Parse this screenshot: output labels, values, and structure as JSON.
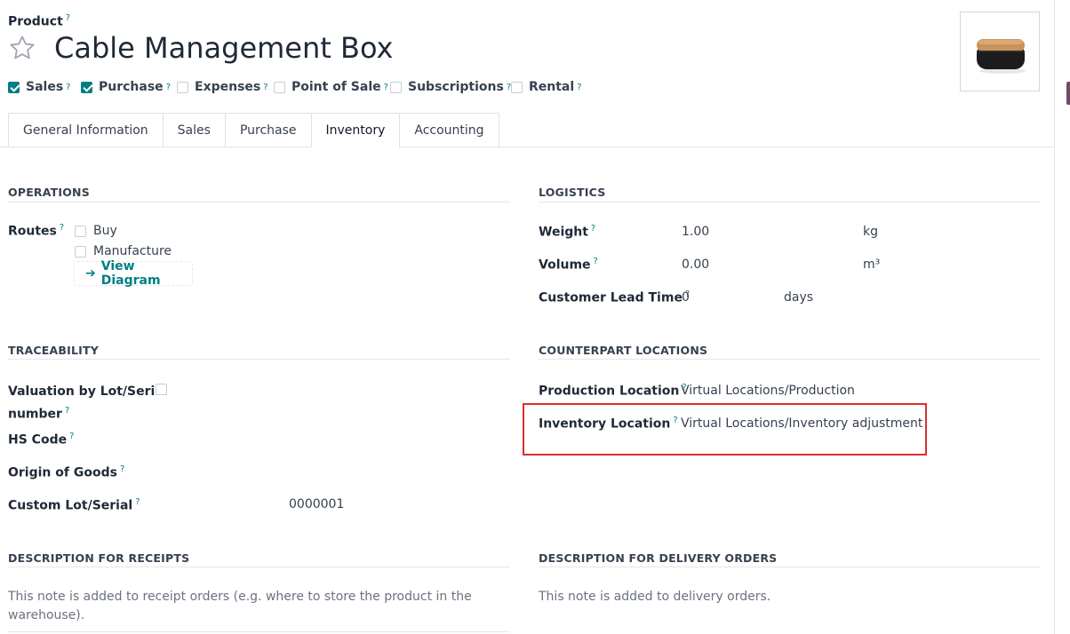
{
  "header": {
    "label": "Product",
    "title": "Cable Management Box",
    "help": "?"
  },
  "toggles": [
    {
      "label": "Sales",
      "checked": true
    },
    {
      "label": "Purchase",
      "checked": true
    },
    {
      "label": "Expenses",
      "checked": false
    },
    {
      "label": "Point of Sale",
      "checked": false
    },
    {
      "label": "Subscriptions",
      "checked": false
    },
    {
      "label": "Rental",
      "checked": false
    }
  ],
  "tabs": [
    "General Information",
    "Sales",
    "Purchase",
    "Inventory",
    "Accounting"
  ],
  "active_tab": "Inventory",
  "operations": {
    "title": "OPERATIONS",
    "routes_label": "Routes",
    "routes": [
      {
        "label": "Buy",
        "checked": false
      },
      {
        "label": "Manufacture",
        "checked": false
      }
    ],
    "view_diagram": "View Diagram"
  },
  "logistics": {
    "title": "LOGISTICS",
    "weight_label": "Weight",
    "weight_value": "1.00",
    "weight_unit": "kg",
    "volume_label": "Volume",
    "volume_value": "0.00",
    "volume_unit": "m³",
    "lead_label": "Customer Lead Time",
    "lead_value": "0",
    "lead_unit": "days"
  },
  "traceability": {
    "title": "TRACEABILITY",
    "valuation_label_1": "Valuation by Lot/Serial",
    "valuation_label_2": "number",
    "hs_label": "HS Code",
    "origin_label": "Origin of Goods",
    "custom_label": "Custom Lot/Serial",
    "custom_value": "0000001"
  },
  "counterpart": {
    "title": "COUNTERPART LOCATIONS",
    "production_label": "Production Location",
    "production_value": "Virtual Locations/Production",
    "inventory_label": "Inventory Location",
    "inventory_value": "Virtual Locations/Inventory adjustment"
  },
  "desc_receipts": {
    "title": "DESCRIPTION FOR RECEIPTS",
    "placeholder_1": "This note is added to receipt orders (e.g. where to store the product in the",
    "placeholder_2": "warehouse)."
  },
  "desc_delivery": {
    "title": "DESCRIPTION FOR DELIVERY ORDERS",
    "placeholder": "This note is added to delivery orders."
  },
  "colors": {
    "accent": "#017e84",
    "highlight": "#d92f2f",
    "brand": "#714b67"
  }
}
